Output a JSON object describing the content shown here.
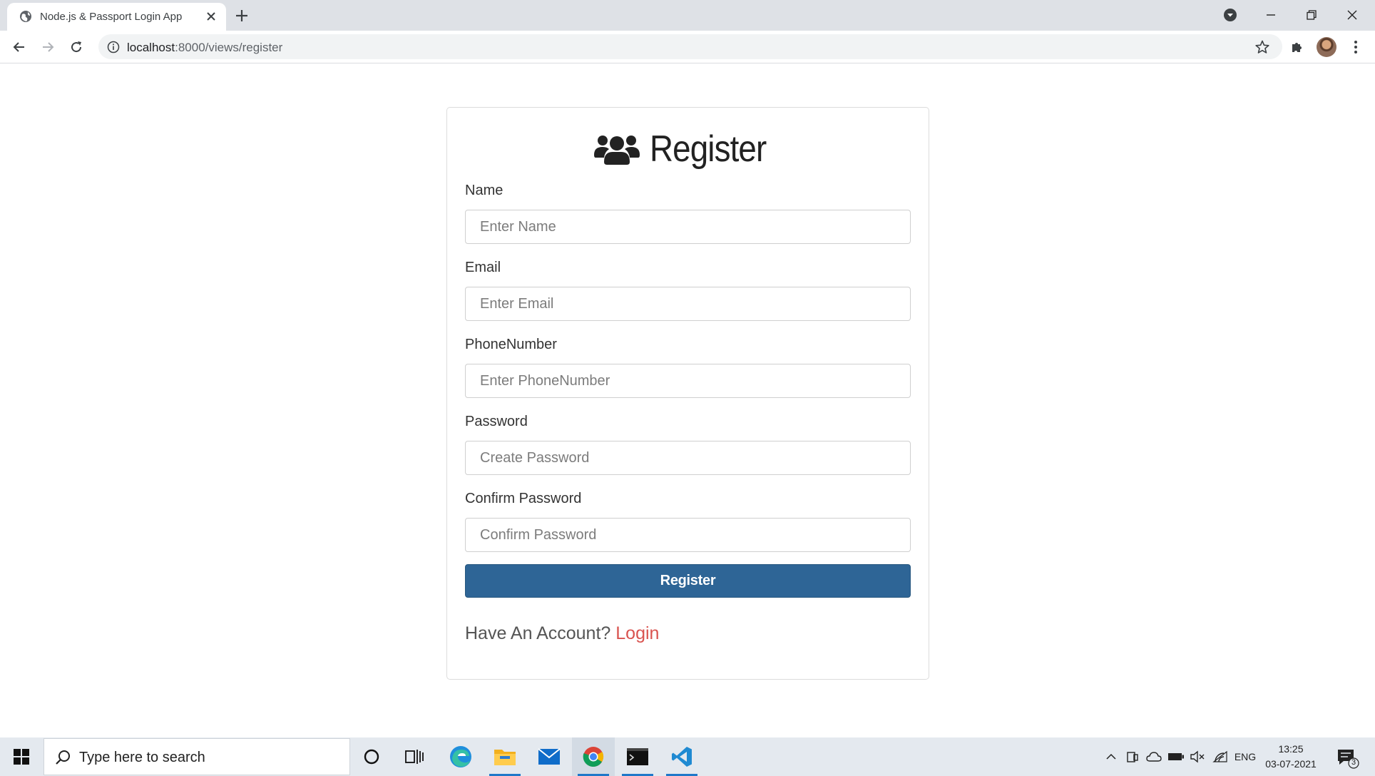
{
  "browser": {
    "tab_title": "Node.js & Passport Login App",
    "url_host": "localhost",
    "url_rest": ":8000/views/register"
  },
  "form": {
    "title": "Register",
    "fields": [
      {
        "label": "Name",
        "placeholder": "Enter Name",
        "type": "text"
      },
      {
        "label": "Email",
        "placeholder": "Enter Email",
        "type": "email"
      },
      {
        "label": "PhoneNumber",
        "placeholder": "Enter PhoneNumber",
        "type": "text"
      },
      {
        "label": "Password",
        "placeholder": "Create Password",
        "type": "password"
      },
      {
        "label": "Confirm Password",
        "placeholder": "Confirm Password",
        "type": "password"
      }
    ],
    "submit_label": "Register",
    "have_account_text": "Have An Account?",
    "login_link": "Login"
  },
  "taskbar": {
    "search_placeholder": "Type here to search",
    "language": "ENG",
    "time": "13:25",
    "date": "03-07-2021",
    "notification_count": "3"
  },
  "colors": {
    "primary_button": "#2e6596",
    "login_link": "#d9534f"
  }
}
